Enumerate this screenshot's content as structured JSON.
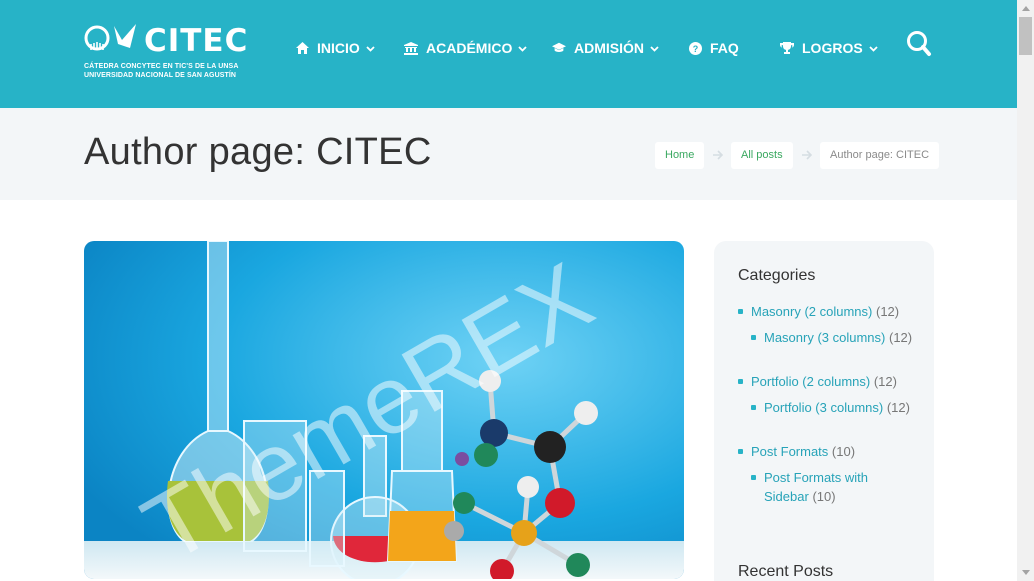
{
  "header": {
    "logo": {
      "wordmark": "CITEC",
      "subtitle_line1": "CÁTEDRA CONCYTEC EN TIC'S DE LA UNSA",
      "subtitle_line2": "UNIVERSIDAD NACIONAL DE SAN AGUSTÍN"
    },
    "nav": [
      {
        "label": "INICIO",
        "icon": "home-icon",
        "has_dropdown": true
      },
      {
        "label": "ACADÉMICO",
        "icon": "university-icon",
        "has_dropdown": true
      },
      {
        "label": "ADMISIÓN",
        "icon": "graduation-cap-icon",
        "has_dropdown": true
      },
      {
        "label": "FAQ",
        "icon": "question-circle-icon",
        "has_dropdown": false
      },
      {
        "label": "LOGROS",
        "icon": "trophy-icon",
        "has_dropdown": true
      }
    ],
    "search_icon": "search-icon"
  },
  "title_bar": {
    "page_title": "Author page: CITEC",
    "breadcrumbs": [
      {
        "label": "Home",
        "link": true
      },
      {
        "label": "All posts",
        "link": true
      },
      {
        "label": "Author page: CITEC",
        "link": false
      }
    ]
  },
  "featured_image": {
    "watermark": "ThemeREX"
  },
  "sidebar": {
    "categories_title": "Categories",
    "categories": [
      {
        "label": "Masonry (2 columns)",
        "count": "(12)",
        "level": 0
      },
      {
        "label": "Masonry (3 columns)",
        "count": "(12)",
        "level": 1
      },
      {
        "label": "Portfolio (2 columns)",
        "count": "(12)",
        "level": 0
      },
      {
        "label": "Portfolio (3 columns)",
        "count": "(12)",
        "level": 1
      },
      {
        "label": "Post Formats",
        "count": "(10)",
        "level": 0
      },
      {
        "label": "Post Formats with Sidebar",
        "count": "(10)",
        "level": 1
      }
    ],
    "recent_posts_title": "Recent Posts"
  },
  "colors": {
    "header_bg": "#27b3c7",
    "title_bar_bg": "#f3f6f8",
    "link": "#27a3b8",
    "breadcrumb_link": "#3aa860"
  }
}
